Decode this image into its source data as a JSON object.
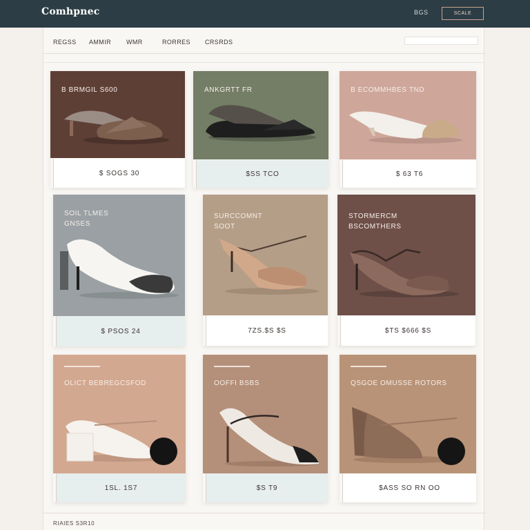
{
  "header": {
    "logo": "Comhpnec",
    "link": "BGS",
    "button": "SCALE"
  },
  "nav": {
    "items": [
      "REGSS",
      "AMMIR",
      "WMR",
      "RORRES",
      "CRSRDS"
    ],
    "search_placeholder": ""
  },
  "colors": {
    "header_bg": "#2d3d45",
    "page_bg": "#f4f0ec",
    "accent": "#c8a48f"
  },
  "products": [
    {
      "title": "B  BRMGIL S600",
      "price": "$ SOGS 30",
      "image_bg": "#5e3f36",
      "shoe": "brown-mule-icon"
    },
    {
      "title": "ANKGRTT FR",
      "price": "$SS TCO",
      "image_bg": "#747d66",
      "shoe": "black-mule-icon"
    },
    {
      "title": "B  ECOMMHBES TND",
      "price": "$ 63 T6",
      "image_bg": "#cfa69a",
      "shoe": "white-mule-icon"
    },
    {
      "title": "SOIL TLMES\nGNSES",
      "price": "$ PSOS 24",
      "image_bg": "#9aa0a3",
      "shoe": "white-pump-icon"
    },
    {
      "title": "SURCCOMNT\nSOOT",
      "price": "7ZS.$S $S",
      "image_bg": "#b59e87",
      "shoe": "strappy-sandal-icon"
    },
    {
      "title": "STORMERCM\nBSCOMTHERS",
      "price": "$TS  $666 $S",
      "image_bg": "#6e5049",
      "shoe": "mauve-sandal-icon"
    },
    {
      "title": "OLICT BEBREGCSFOD",
      "price": "1SL. 1S7",
      "image_bg": "#d3a890",
      "shoe": "block-heel-pompom-icon"
    },
    {
      "title": "OOFFI BSBS",
      "price": "$S  T9",
      "image_bg": "#b48f79",
      "shoe": "slingback-icon"
    },
    {
      "title": "QSGOE OMUSSE ROTORS",
      "price": "$ASS SO RN OO",
      "image_bg": "#b99377",
      "shoe": "wedge-pompom-icon"
    }
  ],
  "footer": {
    "text": "RIAIES S3R10"
  }
}
